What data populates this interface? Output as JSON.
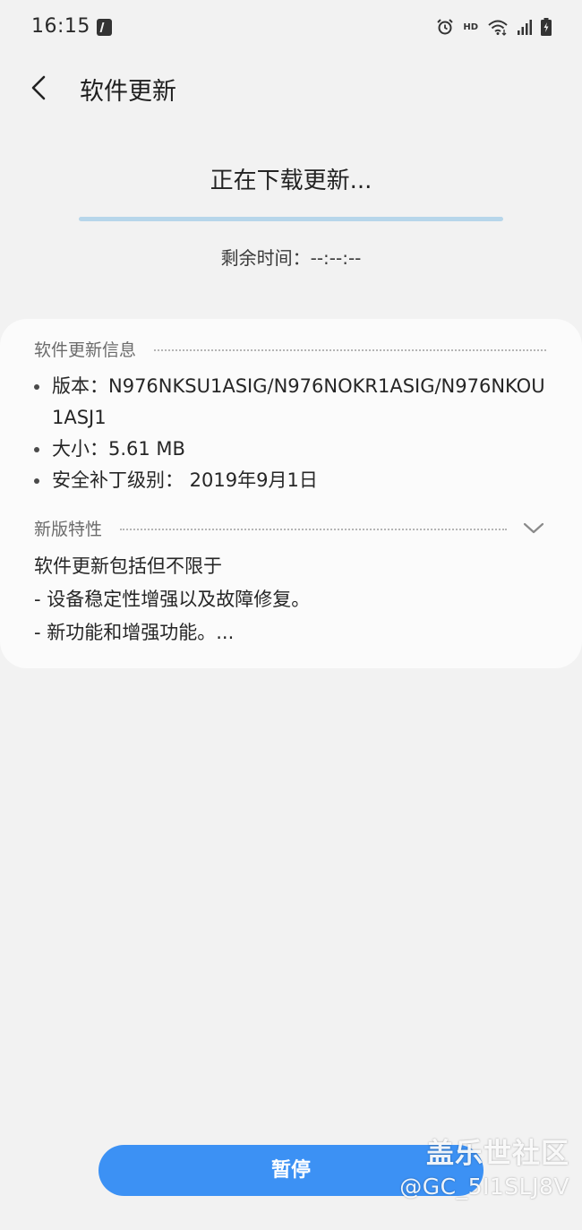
{
  "status_bar": {
    "time": "16:15",
    "hd_label": "HD",
    "icons": [
      "notification-icon",
      "alarm-icon",
      "hd-icon",
      "wifi-icon",
      "signal-icon",
      "battery-icon"
    ]
  },
  "header": {
    "title": "软件更新"
  },
  "download": {
    "status": "正在下载更新...",
    "progress_fraction": 0,
    "remaining": "剩余时间：--:--:--"
  },
  "info": {
    "section_title": "软件更新信息",
    "items": [
      "版本：N976NKSU1ASIG/N976NOKR1ASIG/N976NKOU1ASJ1",
      "大小：5.61 MB",
      "安全补丁级别： 2019年9月1日"
    ]
  },
  "whats_new": {
    "section_title": "新版特性",
    "lines": [
      "软件更新包括但不限于",
      "- 设备稳定性增强以及故障修复。",
      "- 新功能和增强功能。..."
    ]
  },
  "actions": {
    "pause_label": "暂停"
  },
  "watermark": {
    "brand": "盖乐世社区",
    "user": "@GC_5I1SLJ8V"
  },
  "colors": {
    "accent": "#3c91f4",
    "progress_track": "#b7d6ea",
    "background": "#f2f2f2",
    "card": "#fbfbfb"
  }
}
